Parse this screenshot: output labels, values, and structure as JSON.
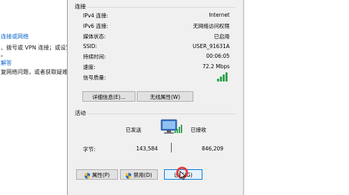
{
  "background": {
    "link1": "连接或网络",
    "line1": "、拨号或 VPN 连接；或设置",
    "line2": "。",
    "link2": "解答",
    "line3": "复网络问题，或者获取疑难"
  },
  "connection": {
    "group_label": "连接",
    "rows": [
      {
        "k": "IPv4 连接:",
        "v": "Internet"
      },
      {
        "k": "IPv6 连接:",
        "v": "无网络访问权限"
      },
      {
        "k": "媒体状态:",
        "v": "已启用"
      },
      {
        "k": "SSID:",
        "v": "USER_91631A"
      },
      {
        "k": "持续时间:",
        "v": "00:06:05"
      },
      {
        "k": "速度:",
        "v": "72.2 Mbps"
      },
      {
        "k": "信号质量:",
        "v": ""
      }
    ],
    "details_button": "详细信息(E)...",
    "wireless_button": "无线属性(W)"
  },
  "activity": {
    "group_label": "活动",
    "sent_label": "已发送",
    "received_label": "已接收",
    "bytes_label": "字节:",
    "sent_bytes": "143,584",
    "received_bytes": "846,209"
  },
  "buttons": {
    "properties": "属性(P)",
    "disable": "禁用(D)",
    "diagnose": "诊断(G)"
  },
  "colors": {
    "signal_green": "#2fa34a",
    "link_blue": "#0a64c8",
    "cursor_red": "#e0393a"
  }
}
